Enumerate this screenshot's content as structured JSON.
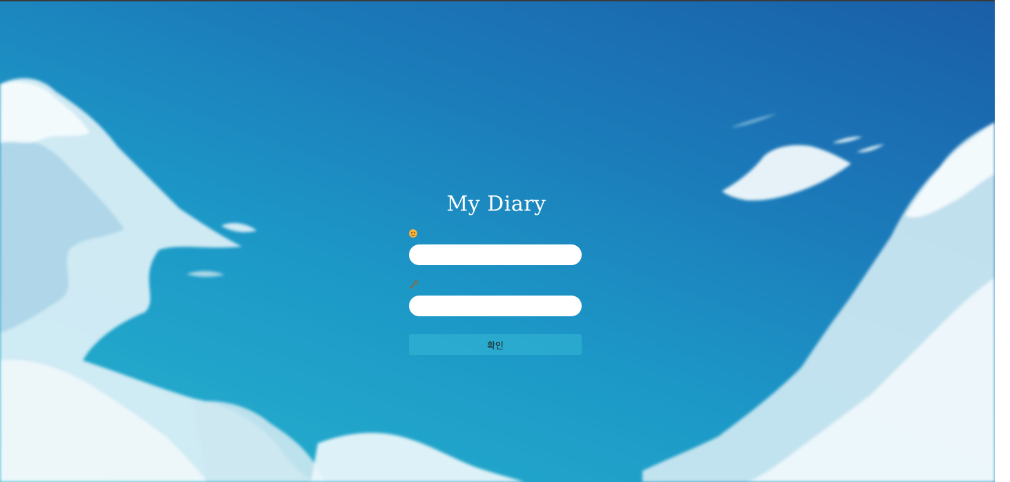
{
  "app": {
    "title": "My Diary"
  },
  "login": {
    "username_icon": "smile-face-icon",
    "username_value": "",
    "password_icon": "key-icon",
    "password_value": "",
    "submit_label": "확인"
  },
  "colors": {
    "sky_top": "#1a5ea8",
    "sky_bottom": "#27b3ce",
    "field_bg": "#ffffff",
    "title_text": "#ffffff"
  }
}
